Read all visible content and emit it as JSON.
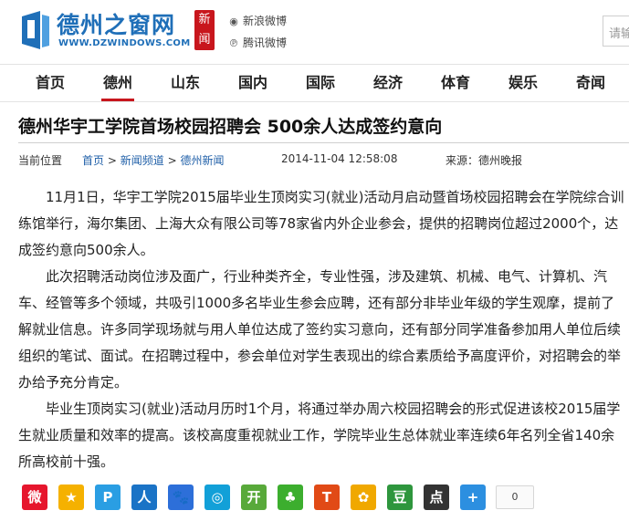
{
  "header": {
    "logo_text": "德州之窗网",
    "logo_url_text": "WWW.DZWINDOWS.COM",
    "badge_text": "新闻",
    "weibo_label": "新浪微博",
    "tencent_label": "腾讯微博",
    "search_placeholder": "请输"
  },
  "nav": {
    "items": [
      {
        "label": "首页"
      },
      {
        "label": "德州",
        "active": true
      },
      {
        "label": "山东"
      },
      {
        "label": "国内"
      },
      {
        "label": "国际"
      },
      {
        "label": "经济"
      },
      {
        "label": "体育"
      },
      {
        "label": "娱乐"
      },
      {
        "label": "奇闻"
      }
    ]
  },
  "article": {
    "title": "德州华宇工学院首场校园招聘会 500余人达成签约意向",
    "location_label": "当前位置",
    "breadcrumb": [
      "首页",
      "新闻频道",
      "德州新闻"
    ],
    "breadcrumb_sep": ">",
    "datetime": "2014-11-04 12:58:08",
    "source": "来源：德州晚报",
    "paragraphs": [
      "11月1日，华宇工学院2015届毕业生顶岗实习(就业)活动月启动暨首场校园招聘会在学院综合训练馆举行，海尔集团、上海大众有限公司等78家省内外企业参会，提供的招聘岗位超过2000个，达成签约意向500余人。",
      "此次招聘活动岗位涉及面广，行业种类齐全，专业性强，涉及建筑、机械、电气、计算机、汽车、经管等多个领域，共吸引1000多名毕业生参会应聘，还有部分非毕业年级的学生观摩，提前了解就业信息。许多同学现场就与用人单位达成了签约实习意向，还有部分同学准备参加用人单位后续组织的笔试、面试。在招聘过程中，参会单位对学生表现出的综合素质给予高度评价，对招聘会的举办给予充分肯定。",
      "毕业生顶岗实习(就业)活动月历时1个月，将通过举办周六校园招聘会的形式促进该校2015届学生就业质量和效率的提高。该校高度重视就业工作，学院毕业生总体就业率连续6年名列全省140余所高校前十强。"
    ]
  },
  "share": {
    "icons": [
      {
        "name": "sina-weibo-icon",
        "glyph": "微",
        "color": "#e6162d"
      },
      {
        "name": "qzone-icon",
        "glyph": "★",
        "color": "#f5b100"
      },
      {
        "name": "tencent-weibo-icon",
        "glyph": "P",
        "color": "#2a9ee3"
      },
      {
        "name": "renren-icon",
        "glyph": "人",
        "color": "#1a73c6"
      },
      {
        "name": "baidu-icon",
        "glyph": "🐾",
        "color": "#2d6fd9"
      },
      {
        "name": "sohu-icon",
        "glyph": "◎",
        "color": "#12a0d8"
      },
      {
        "name": "kaixin-icon",
        "glyph": "开",
        "color": "#58a93a"
      },
      {
        "name": "clover-icon",
        "glyph": "♣",
        "color": "#3cae2e"
      },
      {
        "name": "tianya-icon",
        "glyph": "T",
        "color": "#e14a16"
      },
      {
        "name": "pengyou-icon",
        "glyph": "✿",
        "color": "#f0a800"
      },
      {
        "name": "douban-icon",
        "glyph": "豆",
        "color": "#2e963d"
      },
      {
        "name": "diandian-icon",
        "glyph": "点",
        "color": "#333333"
      },
      {
        "name": "more-share-icon",
        "glyph": "+",
        "color": "#2c8fe0"
      }
    ],
    "count": "0"
  }
}
